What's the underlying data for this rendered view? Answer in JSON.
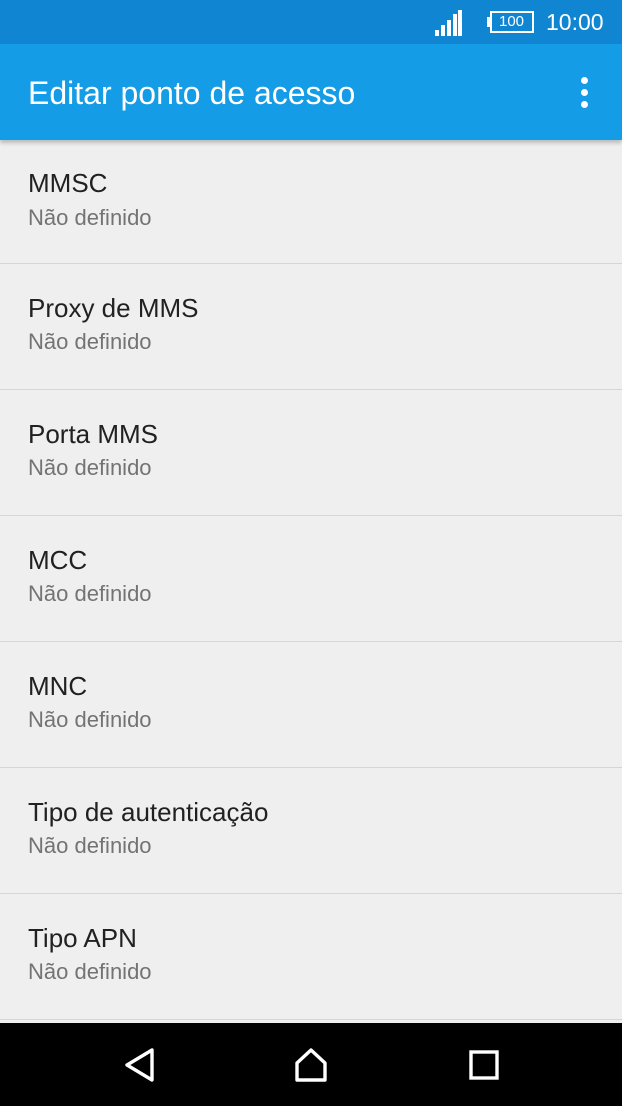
{
  "status_bar": {
    "battery_level": "100",
    "time": "10:00",
    "icons": [
      "signal-icon",
      "battery-icon"
    ]
  },
  "app_bar": {
    "title": "Editar ponto de acesso",
    "menu_icon": "overflow-menu-icon"
  },
  "settings": [
    {
      "title": "MMSC",
      "summary": "Não definido"
    },
    {
      "title": "Proxy de MMS",
      "summary": "Não definido"
    },
    {
      "title": "Porta MMS",
      "summary": "Não definido"
    },
    {
      "title": "MCC",
      "summary": "Não definido"
    },
    {
      "title": "MNC",
      "summary": "Não definido"
    },
    {
      "title": "Tipo de autenticação",
      "summary": "Não definido"
    },
    {
      "title": "Tipo APN",
      "summary": "Não definido"
    }
  ],
  "nav_bar": {
    "icons": [
      "back-icon",
      "home-icon",
      "recents-icon"
    ]
  },
  "colors": {
    "status_bar": "#1085d2",
    "app_bar": "#149ce6",
    "background": "#efefef",
    "divider": "#d6d6d6",
    "title_text": "#212121",
    "summary_text": "#737373",
    "nav_bar": "#000000"
  }
}
